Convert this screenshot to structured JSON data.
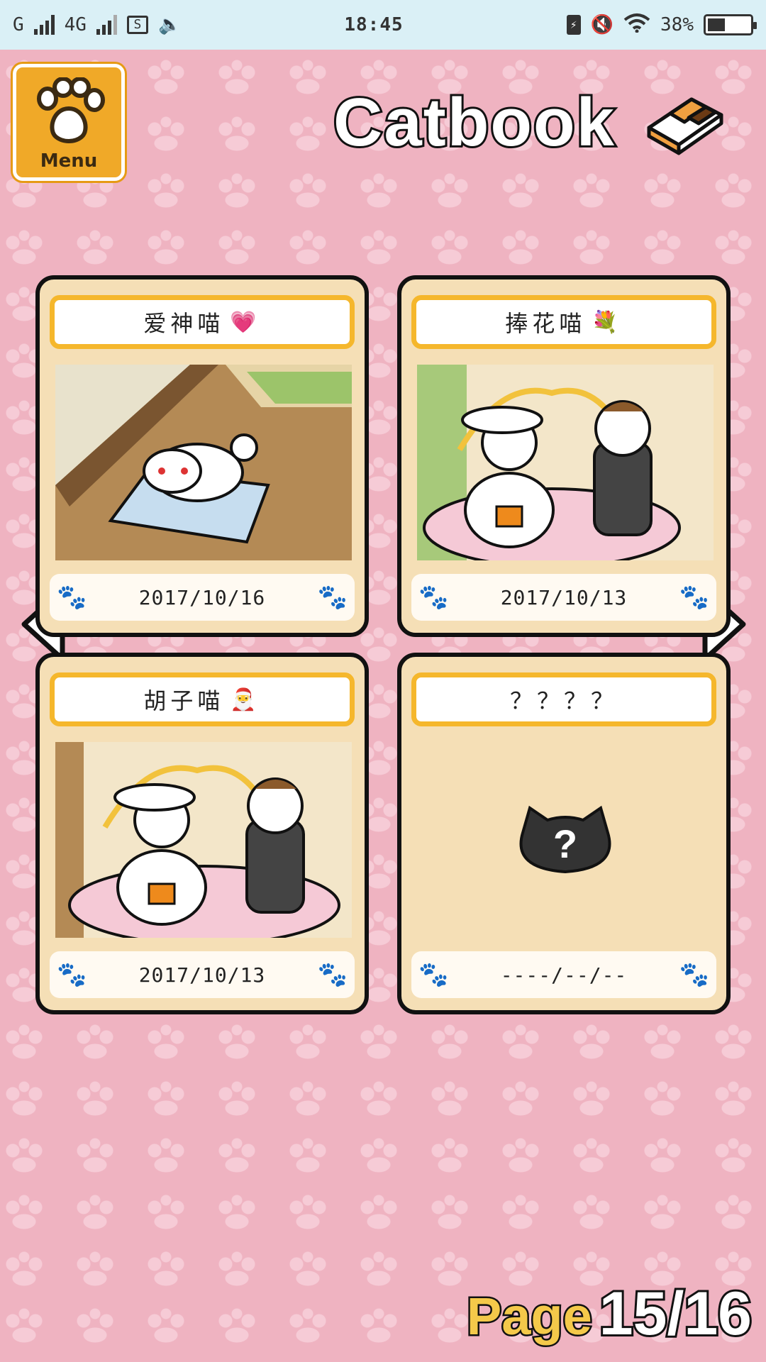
{
  "status_bar": {
    "carrier1": "G",
    "carrier2": "4G",
    "time": "18:45",
    "battery": "38%"
  },
  "header": {
    "menu_label": "Menu",
    "title": "Catbook"
  },
  "cards": [
    {
      "name": "爱神喵",
      "emoji": "💗",
      "date": "2017/10/16"
    },
    {
      "name": "捧花喵",
      "emoji": "💐",
      "date": "2017/10/13"
    },
    {
      "name": "胡子喵",
      "emoji": "🎅",
      "date": "2017/10/13"
    },
    {
      "name": "？？？？",
      "emoji": "",
      "date": "----/--/--"
    }
  ],
  "pagination": {
    "label": "Page",
    "current": "15/16"
  }
}
